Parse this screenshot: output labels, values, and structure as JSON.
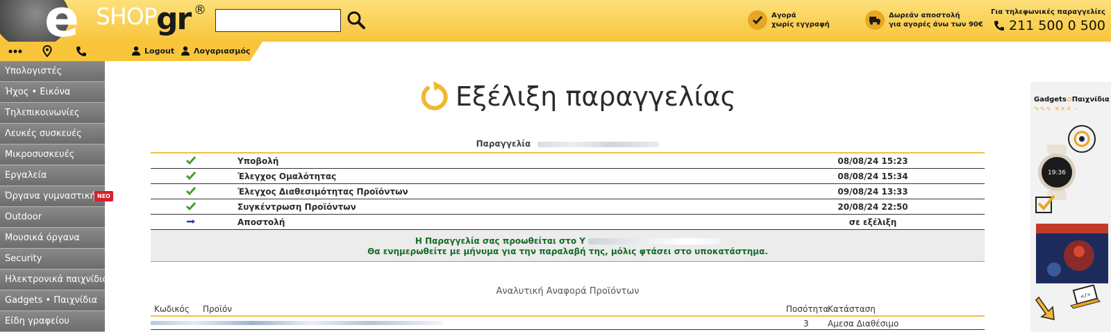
{
  "header": {
    "logo_e": "e",
    "logo_shop": "SHOP",
    "logo_gr": "gr",
    "logo_reg": "®",
    "search": {
      "value": "",
      "placeholder": ""
    },
    "features": [
      {
        "icon": "check-icon",
        "line1": "Αγορά",
        "line2": "χωρίς εγγραφή"
      },
      {
        "icon": "truck-icon",
        "line1": "Δωρεάν αποστολή",
        "line2": "για αγορές άνω των 90€"
      }
    ],
    "phone": {
      "label": "Για τηλεφωνικές παραγγελίες",
      "number": "211 500 0 500"
    }
  },
  "subbar": {
    "logout_label": "Logout",
    "account_label": "Λογαριασμός"
  },
  "sidebar": {
    "items": [
      {
        "label": "Υπολογιστές"
      },
      {
        "label": "Ήχος • Εικόνα"
      },
      {
        "label": "Τηλεπικοινωνίες"
      },
      {
        "label": "Λευκές συσκευές"
      },
      {
        "label": "Μικροσυσκευές"
      },
      {
        "label": "Εργαλεία"
      },
      {
        "label": "Όργανα γυμναστικής",
        "badge": "ΝΕΟ"
      },
      {
        "label": "Outdoor"
      },
      {
        "label": "Μουσικά όργανα"
      },
      {
        "label": "Security"
      },
      {
        "label": "Ηλεκτρονικά παιχνίδια"
      },
      {
        "label": "Gadgets • Παιχνίδια"
      },
      {
        "label": "Είδη γραφείου"
      }
    ]
  },
  "main": {
    "title": "Εξέλιξη παραγγελίας",
    "order_label": "Παραγγελία",
    "steps": [
      {
        "label": "Υποβολή",
        "date": "08/08/24 15:23",
        "status": "done"
      },
      {
        "label": "Έλεγχος Ομαλότητας",
        "date": "08/08/24 15:34",
        "status": "done"
      },
      {
        "label": "Έλεγχος Διαθεσιμότητας Προϊόντων",
        "date": "09/08/24 13:33",
        "status": "done"
      },
      {
        "label": "Συγκέντρωση Προϊόντων",
        "date": "20/08/24 22:50",
        "status": "done"
      },
      {
        "label": "Αποστολή",
        "date": "σε εξέλιξη",
        "status": "in-progress"
      }
    ],
    "notice": {
      "line1": "Η Παραγγελία σας προωθείται στο Υ",
      "line2": "Θα ενημερωθείτε με μήνυμα για την παραλαβή της, μόλις φτάσει στο υποκατάστημα."
    },
    "report": {
      "title": "Αναλυτική Αναφορά Προϊόντων",
      "columns": {
        "code": "Κωδικός",
        "product": "Προϊόν",
        "qty": "Ποσότητα",
        "status": "Κατάσταση"
      },
      "rows": [
        {
          "qty": "3",
          "status": "Αμεσα Διαθέσιμο"
        }
      ]
    }
  },
  "ad": {
    "title_left": "Gadgets",
    "title_right": "Παιχνίδια",
    "sub": "∿∿∿ ××× -"
  },
  "colors": {
    "brand_yellow": "#f8c53a",
    "accent_orange": "#e7a623",
    "sidebar_gray": "#7a7a7a",
    "success_green": "#4a9a2e",
    "notice_green": "#176b27",
    "badge_red": "#d81e2a"
  }
}
